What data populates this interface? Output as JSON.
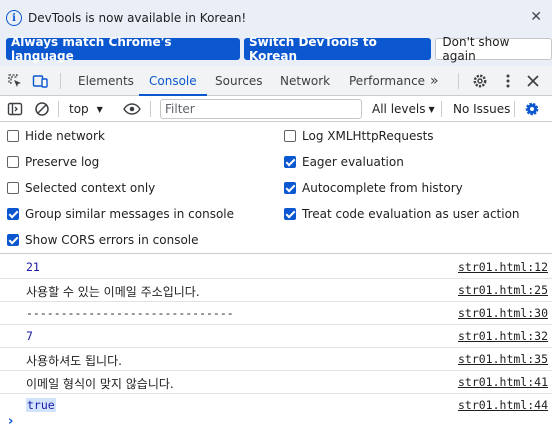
{
  "infobar": {
    "message": "DevTools is now available in Korean!",
    "btn_match": "Always match Chrome's language",
    "btn_switch": "Switch DevTools to Korean",
    "btn_dont_show": "Don't show again",
    "close_glyph": "✕"
  },
  "tabs": {
    "elements": "Elements",
    "console": "Console",
    "sources": "Sources",
    "network": "Network",
    "performance": "Performance",
    "more": "»"
  },
  "toolbar": {
    "context": "top",
    "filter_placeholder": "Filter",
    "levels": "All levels",
    "issues": "No Issues"
  },
  "settings": {
    "hide_network": {
      "label": "Hide network",
      "checked": false
    },
    "preserve_log": {
      "label": "Preserve log",
      "checked": false
    },
    "selected_context": {
      "label": "Selected context only",
      "checked": false
    },
    "group_similar": {
      "label": "Group similar messages in console",
      "checked": true
    },
    "show_cors": {
      "label": "Show CORS errors in console",
      "checked": true
    },
    "log_xhr": {
      "label": "Log XMLHttpRequests",
      "checked": false
    },
    "eager_eval": {
      "label": "Eager evaluation",
      "checked": true
    },
    "autocomplete": {
      "label": "Autocomplete from history",
      "checked": true
    },
    "treat_code": {
      "label": "Treat code evaluation as user action",
      "checked": true
    }
  },
  "messages": [
    {
      "text": "21",
      "source": "str01.html:12",
      "kind": "num"
    },
    {
      "text": "사용할 수 있는 이메일 주소입니다.",
      "source": "str01.html:25",
      "kind": "str"
    },
    {
      "text": "------------------------------",
      "source": "str01.html:30",
      "kind": "str"
    },
    {
      "text": "7",
      "source": "str01.html:32",
      "kind": "num"
    },
    {
      "text": "사용하셔도 됩니다.",
      "source": "str01.html:35",
      "kind": "str"
    },
    {
      "text": "이메일 형식이 맞지 않습니다.",
      "source": "str01.html:41",
      "kind": "str"
    },
    {
      "text": "true",
      "source": "str01.html:44",
      "kind": "bool"
    }
  ],
  "prompt_glyph": "›",
  "colors": {
    "accent": "#0b57d0",
    "infobar_bg": "#e9eef7",
    "tabbar_bg": "#f1f3f4"
  }
}
